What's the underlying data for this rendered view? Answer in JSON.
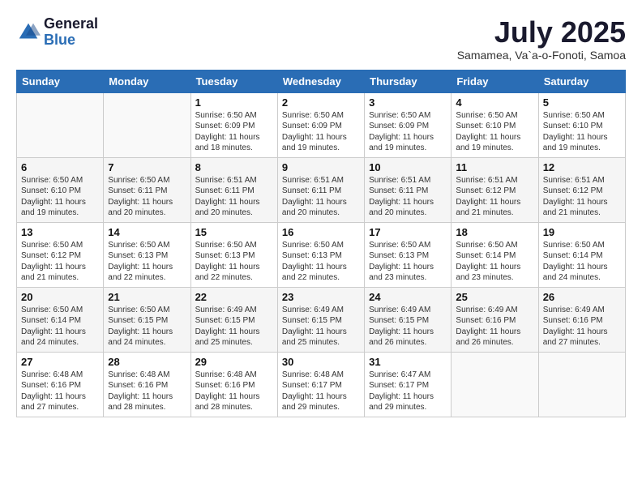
{
  "logo": {
    "general": "General",
    "blue": "Blue"
  },
  "header": {
    "month": "July 2025",
    "location": "Samamea, Va`a-o-Fonoti, Samoa"
  },
  "days_of_week": [
    "Sunday",
    "Monday",
    "Tuesday",
    "Wednesday",
    "Thursday",
    "Friday",
    "Saturday"
  ],
  "weeks": [
    [
      {
        "day": "",
        "sunrise": "",
        "sunset": "",
        "daylight": ""
      },
      {
        "day": "",
        "sunrise": "",
        "sunset": "",
        "daylight": ""
      },
      {
        "day": "1",
        "sunrise": "Sunrise: 6:50 AM",
        "sunset": "Sunset: 6:09 PM",
        "daylight": "Daylight: 11 hours and 18 minutes."
      },
      {
        "day": "2",
        "sunrise": "Sunrise: 6:50 AM",
        "sunset": "Sunset: 6:09 PM",
        "daylight": "Daylight: 11 hours and 19 minutes."
      },
      {
        "day": "3",
        "sunrise": "Sunrise: 6:50 AM",
        "sunset": "Sunset: 6:09 PM",
        "daylight": "Daylight: 11 hours and 19 minutes."
      },
      {
        "day": "4",
        "sunrise": "Sunrise: 6:50 AM",
        "sunset": "Sunset: 6:10 PM",
        "daylight": "Daylight: 11 hours and 19 minutes."
      },
      {
        "day": "5",
        "sunrise": "Sunrise: 6:50 AM",
        "sunset": "Sunset: 6:10 PM",
        "daylight": "Daylight: 11 hours and 19 minutes."
      }
    ],
    [
      {
        "day": "6",
        "sunrise": "Sunrise: 6:50 AM",
        "sunset": "Sunset: 6:10 PM",
        "daylight": "Daylight: 11 hours and 19 minutes."
      },
      {
        "day": "7",
        "sunrise": "Sunrise: 6:50 AM",
        "sunset": "Sunset: 6:11 PM",
        "daylight": "Daylight: 11 hours and 20 minutes."
      },
      {
        "day": "8",
        "sunrise": "Sunrise: 6:51 AM",
        "sunset": "Sunset: 6:11 PM",
        "daylight": "Daylight: 11 hours and 20 minutes."
      },
      {
        "day": "9",
        "sunrise": "Sunrise: 6:51 AM",
        "sunset": "Sunset: 6:11 PM",
        "daylight": "Daylight: 11 hours and 20 minutes."
      },
      {
        "day": "10",
        "sunrise": "Sunrise: 6:51 AM",
        "sunset": "Sunset: 6:11 PM",
        "daylight": "Daylight: 11 hours and 20 minutes."
      },
      {
        "day": "11",
        "sunrise": "Sunrise: 6:51 AM",
        "sunset": "Sunset: 6:12 PM",
        "daylight": "Daylight: 11 hours and 21 minutes."
      },
      {
        "day": "12",
        "sunrise": "Sunrise: 6:51 AM",
        "sunset": "Sunset: 6:12 PM",
        "daylight": "Daylight: 11 hours and 21 minutes."
      }
    ],
    [
      {
        "day": "13",
        "sunrise": "Sunrise: 6:50 AM",
        "sunset": "Sunset: 6:12 PM",
        "daylight": "Daylight: 11 hours and 21 minutes."
      },
      {
        "day": "14",
        "sunrise": "Sunrise: 6:50 AM",
        "sunset": "Sunset: 6:13 PM",
        "daylight": "Daylight: 11 hours and 22 minutes."
      },
      {
        "day": "15",
        "sunrise": "Sunrise: 6:50 AM",
        "sunset": "Sunset: 6:13 PM",
        "daylight": "Daylight: 11 hours and 22 minutes."
      },
      {
        "day": "16",
        "sunrise": "Sunrise: 6:50 AM",
        "sunset": "Sunset: 6:13 PM",
        "daylight": "Daylight: 11 hours and 22 minutes."
      },
      {
        "day": "17",
        "sunrise": "Sunrise: 6:50 AM",
        "sunset": "Sunset: 6:13 PM",
        "daylight": "Daylight: 11 hours and 23 minutes."
      },
      {
        "day": "18",
        "sunrise": "Sunrise: 6:50 AM",
        "sunset": "Sunset: 6:14 PM",
        "daylight": "Daylight: 11 hours and 23 minutes."
      },
      {
        "day": "19",
        "sunrise": "Sunrise: 6:50 AM",
        "sunset": "Sunset: 6:14 PM",
        "daylight": "Daylight: 11 hours and 24 minutes."
      }
    ],
    [
      {
        "day": "20",
        "sunrise": "Sunrise: 6:50 AM",
        "sunset": "Sunset: 6:14 PM",
        "daylight": "Daylight: 11 hours and 24 minutes."
      },
      {
        "day": "21",
        "sunrise": "Sunrise: 6:50 AM",
        "sunset": "Sunset: 6:15 PM",
        "daylight": "Daylight: 11 hours and 24 minutes."
      },
      {
        "day": "22",
        "sunrise": "Sunrise: 6:49 AM",
        "sunset": "Sunset: 6:15 PM",
        "daylight": "Daylight: 11 hours and 25 minutes."
      },
      {
        "day": "23",
        "sunrise": "Sunrise: 6:49 AM",
        "sunset": "Sunset: 6:15 PM",
        "daylight": "Daylight: 11 hours and 25 minutes."
      },
      {
        "day": "24",
        "sunrise": "Sunrise: 6:49 AM",
        "sunset": "Sunset: 6:15 PM",
        "daylight": "Daylight: 11 hours and 26 minutes."
      },
      {
        "day": "25",
        "sunrise": "Sunrise: 6:49 AM",
        "sunset": "Sunset: 6:16 PM",
        "daylight": "Daylight: 11 hours and 26 minutes."
      },
      {
        "day": "26",
        "sunrise": "Sunrise: 6:49 AM",
        "sunset": "Sunset: 6:16 PM",
        "daylight": "Daylight: 11 hours and 27 minutes."
      }
    ],
    [
      {
        "day": "27",
        "sunrise": "Sunrise: 6:48 AM",
        "sunset": "Sunset: 6:16 PM",
        "daylight": "Daylight: 11 hours and 27 minutes."
      },
      {
        "day": "28",
        "sunrise": "Sunrise: 6:48 AM",
        "sunset": "Sunset: 6:16 PM",
        "daylight": "Daylight: 11 hours and 28 minutes."
      },
      {
        "day": "29",
        "sunrise": "Sunrise: 6:48 AM",
        "sunset": "Sunset: 6:16 PM",
        "daylight": "Daylight: 11 hours and 28 minutes."
      },
      {
        "day": "30",
        "sunrise": "Sunrise: 6:48 AM",
        "sunset": "Sunset: 6:17 PM",
        "daylight": "Daylight: 11 hours and 29 minutes."
      },
      {
        "day": "31",
        "sunrise": "Sunrise: 6:47 AM",
        "sunset": "Sunset: 6:17 PM",
        "daylight": "Daylight: 11 hours and 29 minutes."
      },
      {
        "day": "",
        "sunrise": "",
        "sunset": "",
        "daylight": ""
      },
      {
        "day": "",
        "sunrise": "",
        "sunset": "",
        "daylight": ""
      }
    ]
  ]
}
